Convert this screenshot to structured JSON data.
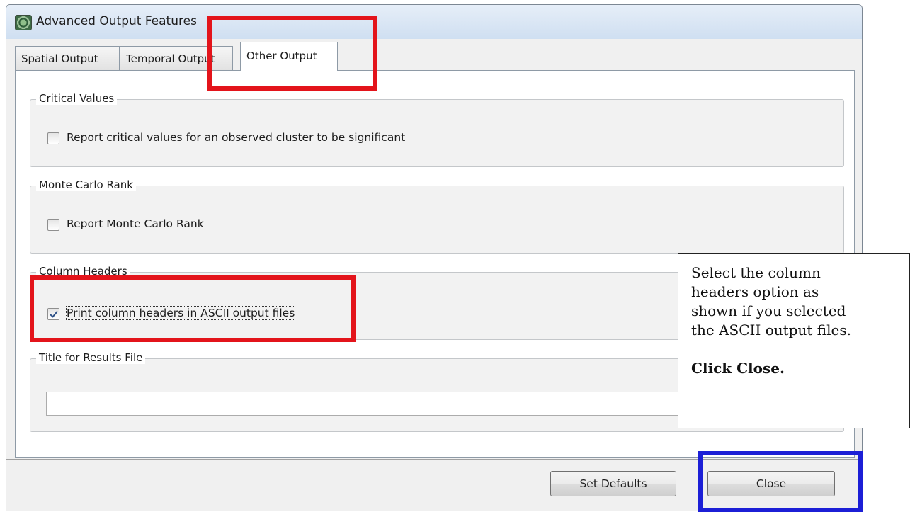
{
  "window": {
    "title": "Advanced Output Features"
  },
  "tabs": [
    {
      "label": "Spatial Output"
    },
    {
      "label": "Temporal Output"
    },
    {
      "label": "Other Output"
    }
  ],
  "groups": {
    "critical_values": {
      "legend": "Critical Values",
      "checkbox_label": "Report critical values for an observed cluster to be significant",
      "checked": false
    },
    "monte_carlo": {
      "legend": "Monte Carlo Rank",
      "checkbox_label": "Report Monte Carlo Rank",
      "checked": false
    },
    "column_headers": {
      "legend": "Column Headers",
      "checkbox_label": "Print column headers in ASCII output files",
      "checked": true
    },
    "title_results": {
      "legend": "Title for Results File",
      "value": ""
    }
  },
  "buttons": {
    "set_defaults": "Set Defaults",
    "close": "Close"
  },
  "annotation": {
    "line1": "Select the column",
    "line2": "headers option as",
    "line3": "shown if you selected",
    "line4": "the ASCII output files.",
    "action": "Click Close."
  },
  "colors": {
    "highlight_red": "#e3141b",
    "highlight_blue": "#1c1fd6"
  }
}
